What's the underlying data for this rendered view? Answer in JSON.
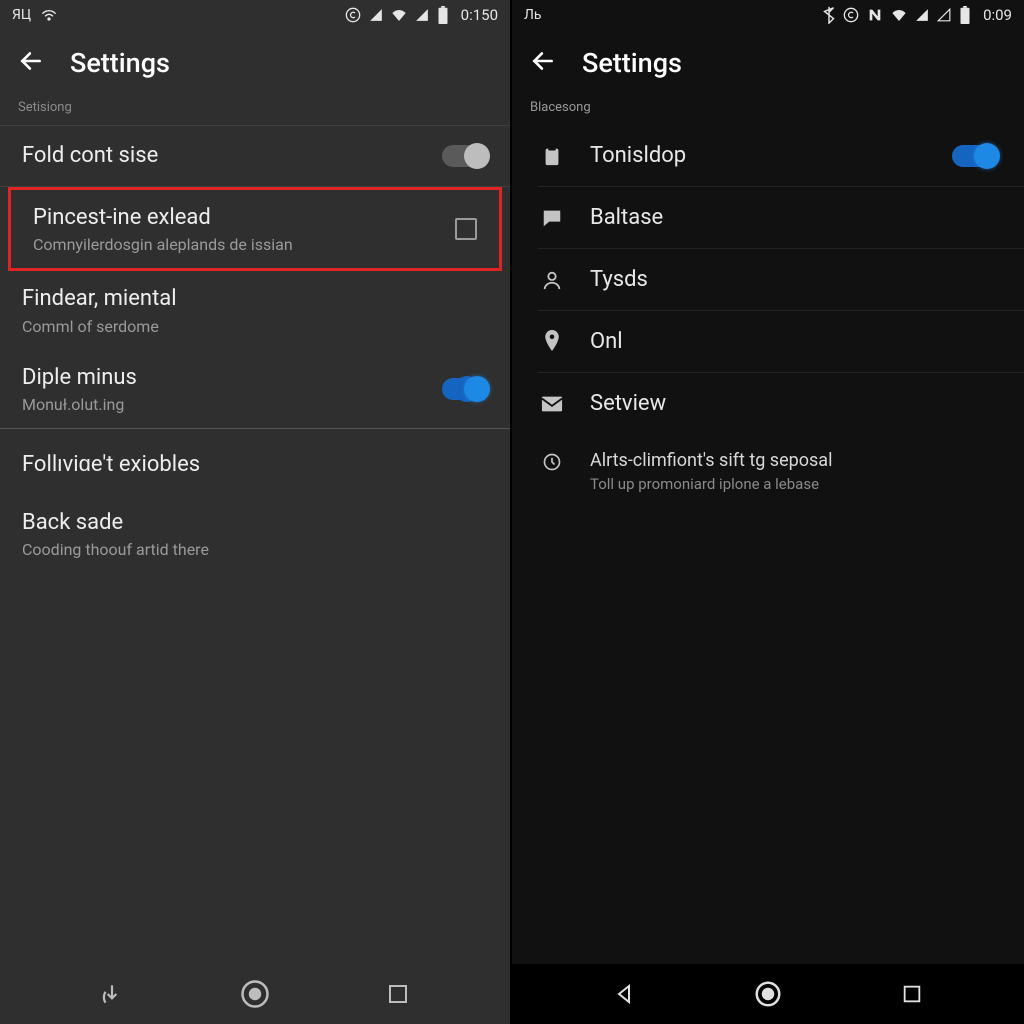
{
  "left": {
    "status": {
      "carrier": "ЯЦ",
      "time": "0:150"
    },
    "app_title": "Settings",
    "section": "Setisiong",
    "rows": [
      {
        "title": "Fold cont sise",
        "subtitle": "",
        "control": "toggle_off"
      },
      {
        "title": "Pincest-ine exlead",
        "subtitle": "Comnyilerdosgin aleplands de issian",
        "control": "checkbox",
        "highlight": true
      },
      {
        "title": "Findear, miental",
        "subtitle": "Comml of serdome",
        "control": "none"
      },
      {
        "title": "Diple minus",
        "subtitle": "Monuł.olut.ing",
        "control": "toggle_on"
      },
      {
        "title": "Follıviɑe't exiobles",
        "subtitle": "",
        "control": "none"
      },
      {
        "title": "Back sade",
        "subtitle": "Cooding thoouf artid there",
        "control": "none"
      }
    ]
  },
  "right": {
    "status": {
      "carrier": "Ль",
      "time": "0:09"
    },
    "app_title": "Settings",
    "section": "Blacesong",
    "rows": [
      {
        "icon": "clipboard",
        "title": "Tonisldop",
        "control": "toggle_on"
      },
      {
        "icon": "chat",
        "title": "Baltase"
      },
      {
        "icon": "person",
        "title": "Tysds"
      },
      {
        "icon": "pin",
        "title": "Onl"
      },
      {
        "icon": "mail",
        "title": "Setview"
      },
      {
        "icon": "clock",
        "title": "Alrts-climfiont's sift tg seposal",
        "subtitle": "Toll up promoniard iplone a lebase"
      }
    ]
  },
  "colors": {
    "accent": "#1e88e5",
    "highlight": "#e02424"
  }
}
